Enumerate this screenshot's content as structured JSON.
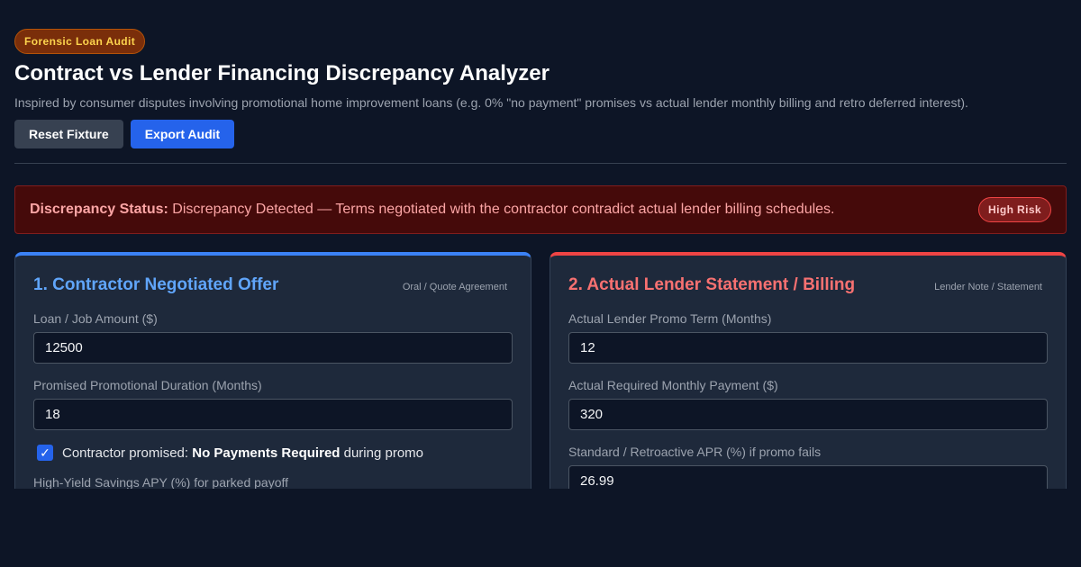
{
  "header": {
    "tag": "Forensic Loan Audit",
    "title": "Contract vs Lender Financing Discrepancy Analyzer",
    "subtitle": "Inspired by consumer disputes involving promotional home improvement loans (e.g. 0% \"no payment\" promises vs actual lender monthly billing and retro deferred interest).",
    "reset_label": "Reset Fixture",
    "export_label": "Export Audit"
  },
  "status": {
    "label": "Discrepancy Status:",
    "message": " Discrepancy Detected — Terms negotiated with the contractor contradict actual lender billing schedules.",
    "badge": "High Risk"
  },
  "contractor": {
    "title": "1. Contractor Negotiated Offer",
    "tag": "Oral / Quote Agreement",
    "loan_label": "Loan / Job Amount ($)",
    "loan_value": "12500",
    "duration_label": "Promised Promotional Duration (Months)",
    "duration_value": "18",
    "check_prefix": "Contractor promised: ",
    "check_bold": "No Payments Required",
    "check_suffix": " during promo",
    "apy_label": "High-Yield Savings APY (%) for parked payoff"
  },
  "lender": {
    "title": "2. Actual Lender Statement / Billing",
    "tag": "Lender Note / Statement",
    "term_label": "Actual Lender Promo Term (Months)",
    "term_value": "12",
    "payment_label": "Actual Required Monthly Payment ($)",
    "payment_value": "320",
    "apr_label": "Standard / Retroactive APR (%) if promo fails",
    "apr_value": "26.99"
  }
}
